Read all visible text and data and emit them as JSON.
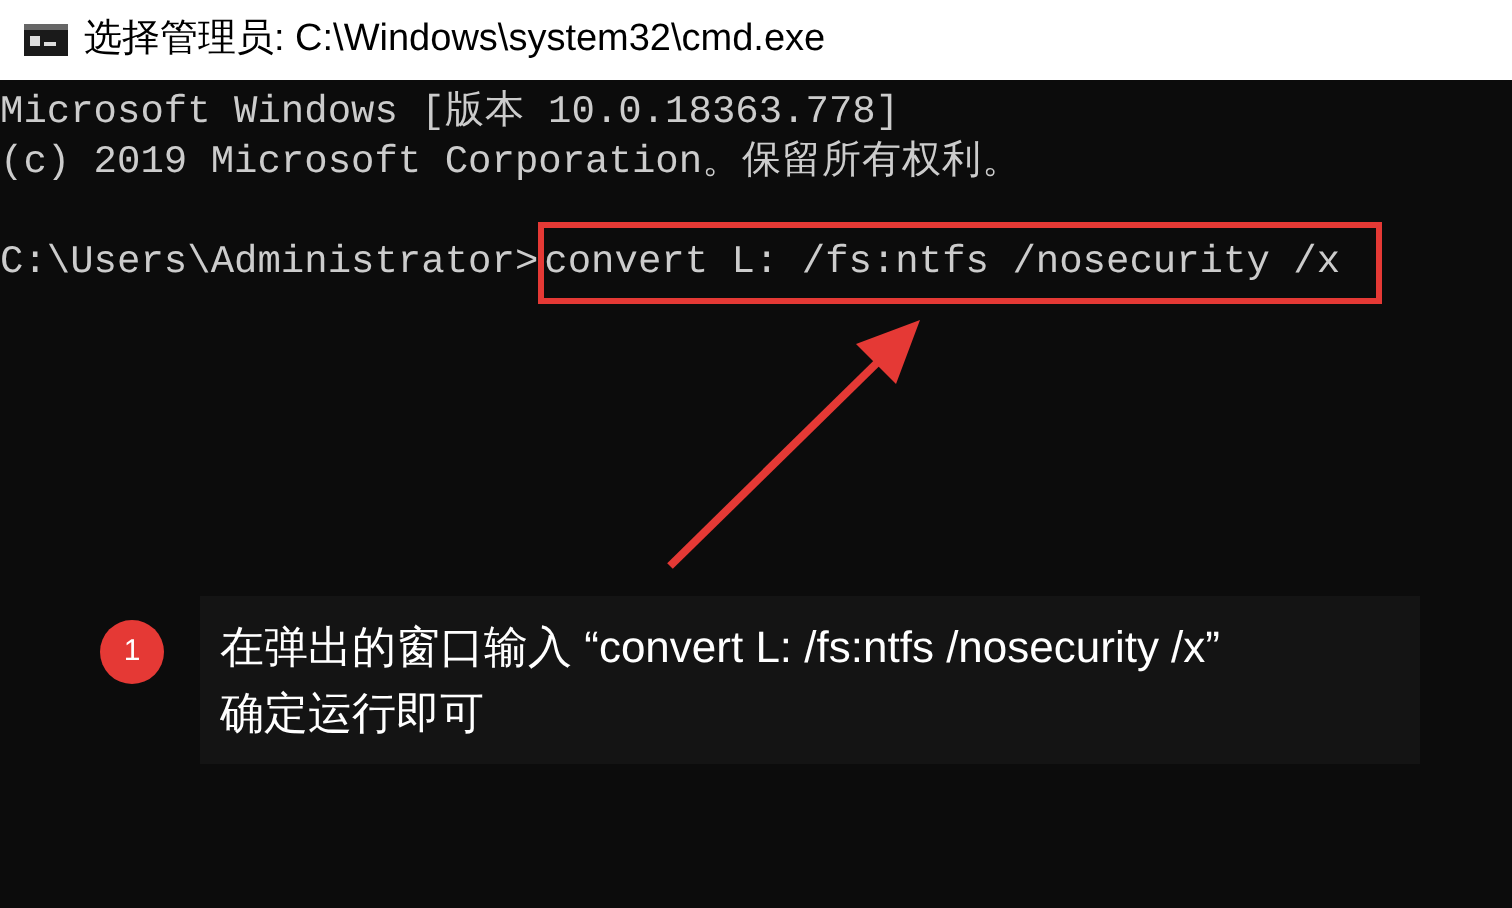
{
  "window": {
    "title": "选择管理员: C:\\Windows\\system32\\cmd.exe"
  },
  "console": [
    {
      "kind": "output",
      "text": "Microsoft Windows [版本 10.0.18363.778]"
    },
    {
      "kind": "output",
      "text": "(c) 2019 Microsoft Corporation。保留所有权利。"
    },
    {
      "kind": "blank"
    },
    {
      "kind": "input",
      "prompt": "C:\\Users\\Administrator>",
      "command": "convert L: /fs:ntfs /nosecurity /x",
      "highlighted": true
    }
  ],
  "callout": {
    "number": "1",
    "text": "在弹出的窗口输入 “convert L: /fs:ntfs /nosecurity /x”\n确定运行即可"
  }
}
